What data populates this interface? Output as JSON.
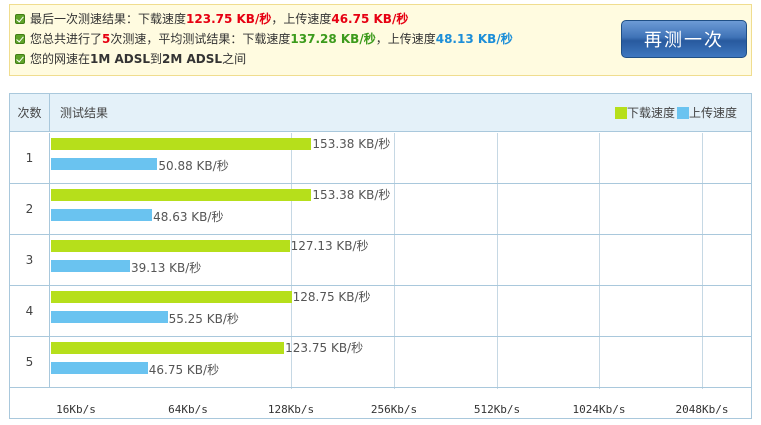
{
  "summary": {
    "line1": {
      "prefix": "最后一次测速结果：下载速度",
      "download": "123.75 KB/秒",
      "mid": "，上传速度",
      "upload": "46.75 KB/秒"
    },
    "line2": {
      "prefix": "您总共进行了",
      "count": "5",
      "mid1": "次测速，平均测试结果：下载速度",
      "download": "137.28 KB/秒",
      "mid2": "，上传速度",
      "upload": "48.13 KB/秒"
    },
    "line3": {
      "prefix": "您的网速在",
      "low": "1M ADSL",
      "mid": "到",
      "high": "2M ADSL",
      "suffix": "之间"
    },
    "retest_button": "再测一次"
  },
  "table": {
    "col_count": "次数",
    "col_result": "测试结果",
    "legend_download": "下载速度",
    "legend_upload": "上传速度",
    "colors": {
      "download": "#b6df1b",
      "upload": "#6ac3f0"
    },
    "axis_ticks": [
      "16Kb/s",
      "64Kb/s",
      "128Kb/s",
      "256Kb/s",
      "512Kb/s",
      "1024Kb/s",
      "2048Kb/s"
    ],
    "rows": [
      {
        "num": "1",
        "download": 153.38,
        "download_label": "153.38 KB/秒",
        "upload": 50.88,
        "upload_label": "50.88 KB/秒"
      },
      {
        "num": "2",
        "download": 153.38,
        "download_label": "153.38 KB/秒",
        "upload": 48.63,
        "upload_label": "48.63 KB/秒"
      },
      {
        "num": "3",
        "download": 127.13,
        "download_label": "127.13 KB/秒",
        "upload": 39.13,
        "upload_label": "39.13 KB/秒"
      },
      {
        "num": "4",
        "download": 128.75,
        "download_label": "128.75 KB/秒",
        "upload": 55.25,
        "upload_label": "55.25 KB/秒"
      },
      {
        "num": "5",
        "download": 123.75,
        "download_label": "123.75 KB/秒",
        "upload": 46.75,
        "upload_label": "46.75 KB/秒"
      }
    ]
  }
}
